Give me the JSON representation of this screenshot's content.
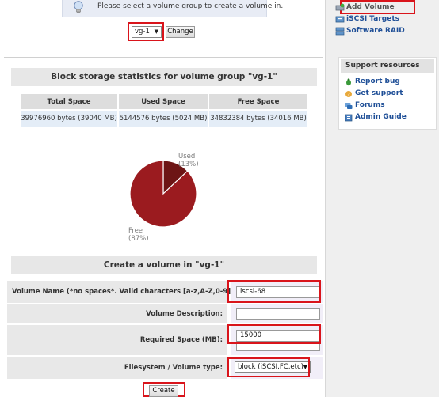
{
  "notice": {
    "text": "Please select a volume group to create a volume in."
  },
  "volume_group_selector": {
    "selected": "vg-1",
    "change_label": "Change"
  },
  "stats": {
    "title": "Block storage statistics for volume group \"vg-1\"",
    "headers": [
      "Total Space",
      "Used Space",
      "Free Space"
    ],
    "values": [
      "39976960 bytes (39040 MB)",
      "5144576 bytes (5024 MB)",
      "34832384 bytes (34016 MB)"
    ]
  },
  "chart_data": {
    "type": "pie",
    "slices": [
      {
        "label": "Used",
        "percent_label": "(13%)",
        "value": 13,
        "color": "#6d1515"
      },
      {
        "label": "Free",
        "percent_label": "(87%)",
        "value": 87,
        "color": "#9b1b1f"
      }
    ]
  },
  "create_form": {
    "title": "Create a volume in \"vg-1\"",
    "volume_name_label": "Volume Name (*no spaces*. Valid characters [a-z,A-Z,0-9]):",
    "volume_name_value": "iscsi-68",
    "description_label": "Volume Description:",
    "description_value": "",
    "required_space_label": "Required Space (MB):",
    "required_space_value": "15000",
    "fs_type_label": "Filesystem / Volume type:",
    "fs_type_selected": "block (iSCSI,FC,etc)",
    "create_label": "Create"
  },
  "sidebar": {
    "links": [
      {
        "label": "Add Volume",
        "icon": "add-volume-icon"
      },
      {
        "label": "iSCSI Targets",
        "icon": "iscsi-targets-icon"
      },
      {
        "label": "Software RAID",
        "icon": "software-raid-icon"
      }
    ],
    "support": {
      "title": "Support resources",
      "links": [
        {
          "label": "Report bug",
          "icon": "report-bug-icon"
        },
        {
          "label": "Get support",
          "icon": "get-support-icon"
        },
        {
          "label": "Forums",
          "icon": "forums-icon"
        },
        {
          "label": "Admin Guide",
          "icon": "admin-guide-icon"
        }
      ]
    }
  },
  "colors": {
    "highlight_border": "#d9141b",
    "link": "#1f4f97",
    "pie_used": "#6d1515",
    "pie_free": "#9b1b1f"
  }
}
